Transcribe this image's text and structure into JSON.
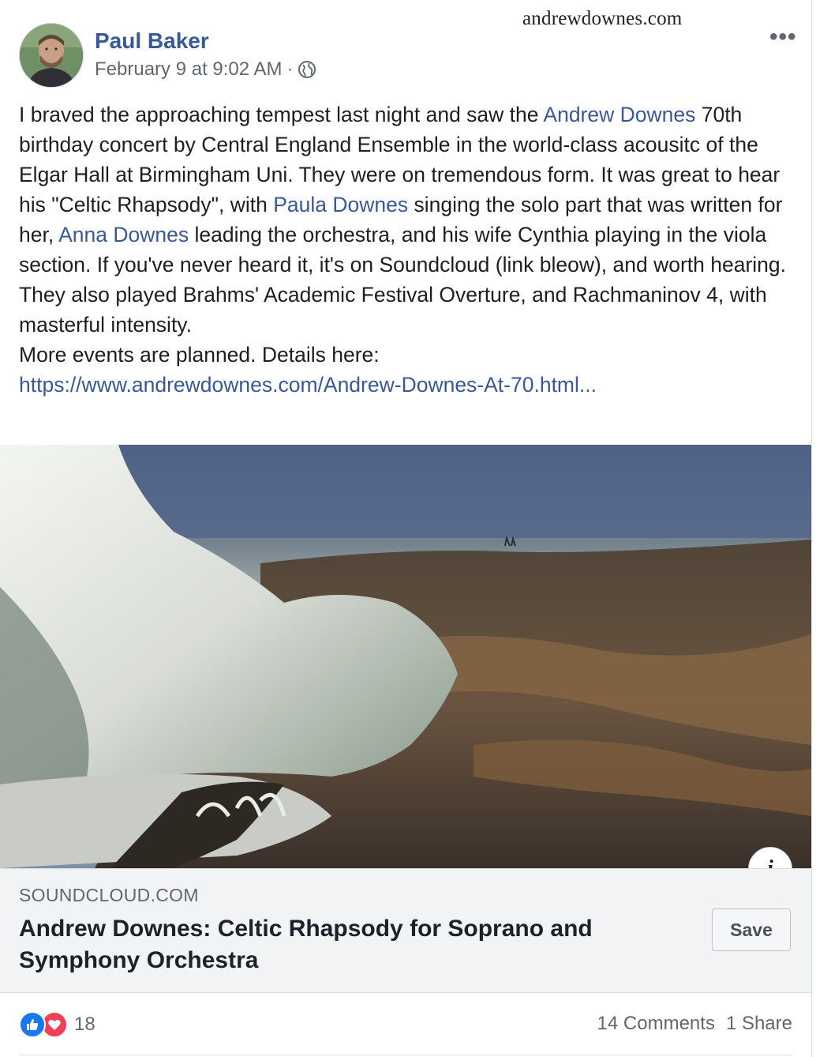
{
  "watermark": "andrewdownes.com",
  "post": {
    "author": "Paul Baker",
    "timestamp": "February 9 at 9:02 AM",
    "separator": "·",
    "privacy_icon": "globe-icon",
    "more_icon": "•••",
    "text": {
      "p1_a": "I braved the approaching tempest last night and saw the ",
      "mention_1": "Andrew Downes",
      "p1_b": " 70th birthday concert by Central England Ensemble in the world-class acousitc of the Elgar Hall at Birmingham Uni. They were on tremendous form. It was great to hear his \"Celtic Rhapsody\", with ",
      "mention_2": "Paula Downes",
      "p1_c": " singing the solo part that was written for her, ",
      "mention_3": "Anna Downes",
      "p1_d": " leading the orchestra, and his wife Cynthia playing in the viola section. If you've never heard it, it's on Soundcloud (link bleow), and worth hearing.",
      "p2": "They also played Brahms' Academic Festival Overture, and Rachmaninov 4, with masterful intensity.",
      "p3": "More events are planned. Details here:",
      "url": "https://www.andrewdownes.com/Andrew-Downes-At-70.html..."
    }
  },
  "link_preview": {
    "domain": "SOUNDCLOUD.COM",
    "title": "Andrew Downes: Celtic Rhapsody for Soprano and Symphony Orchestra",
    "save_label": "Save",
    "info_label": "i"
  },
  "footer": {
    "reaction_count": "18",
    "comments": "14 Comments",
    "shares": "1 Share"
  },
  "colors": {
    "link": "#385898",
    "like": "#1877f2",
    "love": "#f33e58"
  }
}
